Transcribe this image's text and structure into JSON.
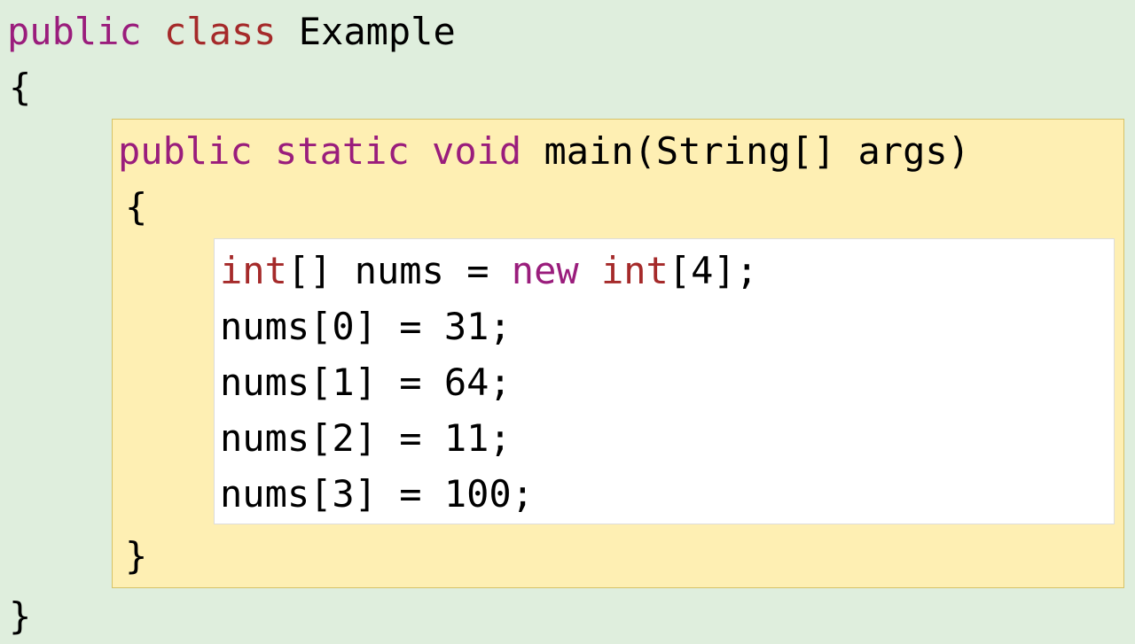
{
  "classDecl": {
    "kw_public": "public",
    "kw_class": "class",
    "name": "Example"
  },
  "openBrace": "{",
  "methodDecl": {
    "kw_public": "public",
    "kw_static": "static",
    "kw_void": "void",
    "name": "main",
    "params": "(String[] args)"
  },
  "methodOpen": "{",
  "arrayDecl": {
    "kw_int": "int",
    "brackets": "[]",
    "varname": "nums",
    "eq": "=",
    "kw_new": "new",
    "kw_int2": "int",
    "size": "[4];"
  },
  "assigns": [
    "nums[0] = 31;",
    "nums[1] = 64;",
    "nums[2] = 11;",
    "nums[3] = 100;"
  ],
  "methodClose": "}",
  "closeBrace": "}"
}
